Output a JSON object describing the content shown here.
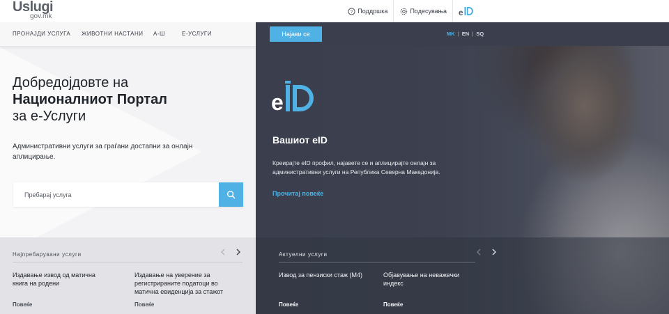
{
  "header": {
    "logo_main": "Uslugi",
    "logo_sub": "gov.mk",
    "support_label": "Поддршка",
    "settings_label": "Подесувања",
    "eid_label": "eID"
  },
  "nav": {
    "items": [
      {
        "label": "ПРОНАЈДИ УСЛУГА"
      },
      {
        "label": "ЖИВОТНИ НАСТАНИ"
      },
      {
        "label": "А-Ш"
      },
      {
        "label": "Е-УСЛУГИ"
      }
    ]
  },
  "welcome": {
    "line1": "Добредојдовте на",
    "line2": "Националниот Портал",
    "line3": "за е-Услуги",
    "intro": "Административни услуги за граѓани достапни за онлајн аплицирање."
  },
  "search": {
    "placeholder": "Пребарај услуга"
  },
  "popular": {
    "title": "Најпребарувани услуги",
    "services": [
      {
        "label": "Издавање извод од матична книга на родени",
        "more": "Повеќе"
      },
      {
        "label": "Издавање на уверение за регистрираните податоци во матична евиденција за стажот",
        "more": "Повеќе"
      }
    ]
  },
  "login": {
    "label": "Најави се"
  },
  "languages": {
    "items": [
      {
        "label": "MK",
        "active": true
      },
      {
        "label": "EN",
        "active": false
      },
      {
        "label": "SQ",
        "active": false
      }
    ]
  },
  "eid_section": {
    "title": "Вашиот eID",
    "description": "Креирајте eID профил, најавете се и аплицирајте онлајн за административни услуги на Република Северна Македонија.",
    "read_more": "Прочитај повеќе"
  },
  "current": {
    "title": "Актуелни услуги",
    "services": [
      {
        "label": "Извод за пензиски стаж (М4)",
        "more": "Повеќе"
      },
      {
        "label": "Објавување на неважечки индекс",
        "more": "Повеќе"
      }
    ]
  },
  "colors": {
    "accent": "#4fb1e4",
    "dark_panel": "#3e4351",
    "light_panel": "#f3f3f5"
  }
}
